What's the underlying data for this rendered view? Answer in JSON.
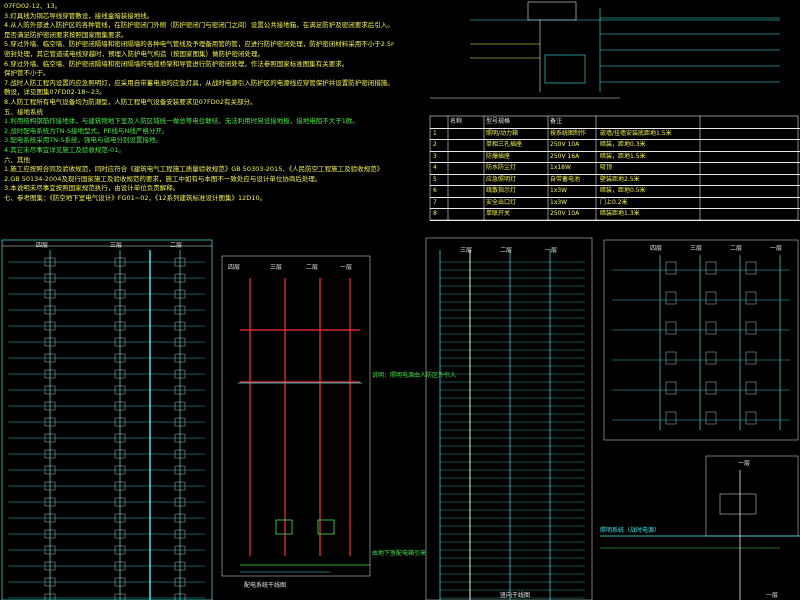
{
  "notes": [
    {
      "text": "07FD02-12、13。",
      "color": "#f5f54a"
    },
    {
      "text": "3.灯具线为铜芯导线穿管敷设，接线盒暗装接地线。",
      "color": "#f5f54a"
    },
    {
      "text": "4.从人防外部进入防护区的各种管线，在防护密闭门外侧（防护密闭门与密闭门之间）设置公共接地箱，在满足防护及密闭要求后引入。",
      "color": "#f5f54a"
    },
    {
      "text": "   是否满足防护密闭要求按照国家图集要求。",
      "color": "#f5f54a"
    },
    {
      "text": "5.穿过外墙、临空墙、防护密闭隔墙和密闭隔墙的各种电气管线及予埋备用管的管，应进行防护密闭处理，防护密闭材料采用不小于2.5mm的钢板",
      "color": "#f5f54a"
    },
    {
      "text": "   密封处理，其它管道或电线穿越时，预埋入防护电气构造（按国家图集）做防护密闭处理。",
      "color": "#f5f54a"
    },
    {
      "text": "6.穿过外墙、临空墙、防护密闭隔墙和密闭隔墙的电缆桥架和导管进行防护密闭处理，作法参照国家标准图集有关要求。",
      "color": "#f5f54a"
    },
    {
      "text": "   保护管不小于。",
      "color": "#f5f54a"
    },
    {
      "text": "7.战时人防工程内设置的应急照明灯，应采用自带蓄电池的应急灯具，从战时电源引入防护区的电源线应穿管保护并设置防护密闭措施。",
      "color": "#f5f54a"
    },
    {
      "text": "   敷设，详见图集07FD02-18~23。",
      "color": "#f5f54a"
    },
    {
      "text": "8.人防工程所有电气设备均为防潮型，人防工程电气设备安装要求见07FD02有关部分。",
      "color": "#f5f54a"
    },
    {
      "text": "五、接地系统",
      "color": "#f5f54a"
    },
    {
      "text": "  1.利用结构钢筋作接地体，与建筑物地下室及人防区域统一做总等电位联结，无法利用时另设接地极，接地电阻不大于1欧。",
      "color": "#46e846"
    },
    {
      "text": "  2.战时配电系统为TN-S接地型式，PE线与N线严格分开。",
      "color": "#46e846"
    },
    {
      "text": "  3.配电系统采用TN-S系统，强电与弱电分别设置接地。",
      "color": "#46e846"
    },
    {
      "text": "  4.其它未尽事宜详见施工及验收规范-01。",
      "color": "#46e846"
    },
    {
      "text": "六、其他",
      "color": "#f5f54a"
    },
    {
      "text": "1.施工应按照合同及验收规范，同时应符合《建筑电气工程施工质量验收规范》GB 50303-2015、《人民防空工程施工及验收规范》",
      "color": "#f5f54a"
    },
    {
      "text": "2.GB 50134-2004及现行国家施工及验收规范的要求，施工中如有与本图不一致处应与设计单位协商后处理。",
      "color": "#f5f54a"
    },
    {
      "text": "3.本说明未尽事宜按照国家规范执行，由设计单位负责解释。",
      "color": "#f5f54a"
    },
    {
      "text": "七、参考图集：《防空地下室电气设计》FG01~02，《12系列建筑标准设计图集》12D10。",
      "color": "#f5f54a"
    }
  ],
  "legend_table": {
    "headers": [
      "符号",
      "名称",
      "型号规格",
      "备注"
    ],
    "rows": [
      {
        "no": "1",
        "name": "照明/动力箱",
        "model": "按系统图制作",
        "note": "嵌墙/挂墙安装底距地1.5米"
      },
      {
        "no": "2",
        "name": "单相三孔插座",
        "model": "250V 10A",
        "note": "暗装，距地0.3米"
      },
      {
        "no": "3",
        "name": "防爆插座",
        "model": "250V 16A",
        "note": "暗装，距地1.5米"
      },
      {
        "no": "4",
        "name": "防水防尘灯",
        "model": "1x18W",
        "note": "吸顶"
      },
      {
        "no": "5",
        "name": "应急照明灯",
        "model": "自带蓄电池",
        "note": "壁装距地2.5米"
      },
      {
        "no": "6",
        "name": "疏散指示灯",
        "model": "1x3W",
        "note": "暗装，距地0.5米"
      },
      {
        "no": "7",
        "name": "安全出口灯",
        "model": "1x3W",
        "note": "门上0.2米"
      },
      {
        "no": "8",
        "name": "单联开关",
        "model": "250V 10A",
        "note": "暗装距地1.3米"
      }
    ]
  },
  "labels": {
    "riser_a": [
      "四层",
      "三层",
      "二层"
    ],
    "riser_b": [
      "四层",
      "三层",
      "二层",
      "一层"
    ],
    "riser_c": [
      "三层",
      "二层",
      "一层"
    ],
    "riser_d": [
      "四层",
      "三层",
      "二层",
      "一层"
    ],
    "riser_e": [
      "一层"
    ],
    "caption_b": "配电系统干线图",
    "caption_c": "竖向干线图",
    "caption_e": "一层",
    "system_caption": "照明系统（战时电源）",
    "side_note_b": "说明：照明电源由人防区外引入",
    "side_note_c": "由地下室配电箱引来"
  },
  "colors": {
    "cyan": "#3ee8e8",
    "yellow": "#f5f54a",
    "green": "#46e846",
    "red": "#ff3030",
    "white": "#e8e8e8"
  }
}
